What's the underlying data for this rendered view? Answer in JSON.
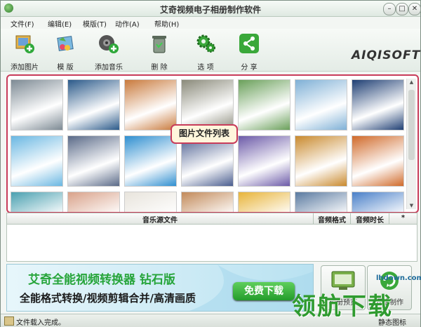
{
  "window": {
    "title": "艾奇视频电子相册制作软件"
  },
  "menu": [
    {
      "label": "文件(F)"
    },
    {
      "label": "编辑(E)"
    },
    {
      "label": "模版(T)"
    },
    {
      "label": "动作(A)"
    },
    {
      "label": "帮助(H)"
    }
  ],
  "toolbar": [
    {
      "label": "添加图片",
      "icon": "add-image-icon"
    },
    {
      "label": "模 版",
      "icon": "template-icon"
    },
    {
      "label": "添加音乐",
      "icon": "add-music-icon"
    },
    {
      "label": "删 除",
      "icon": "trash-icon"
    },
    {
      "label": "选 项",
      "icon": "gear-icon"
    },
    {
      "label": "分 享",
      "icon": "share-icon"
    }
  ],
  "logo": "AIQISOFT",
  "image_list": {
    "callout": "图片文件列表",
    "thumbnails": [
      {
        "subject": "eiffel-tower",
        "color": "#7d8a94"
      },
      {
        "subject": "earth-orbit",
        "color": "#2b5a8a"
      },
      {
        "subject": "stonehenge",
        "color": "#c97a3c"
      },
      {
        "subject": "stones-flowers",
        "color": "#8a8a7a"
      },
      {
        "subject": "duckling",
        "color": "#6aa05a"
      },
      {
        "subject": "ferris-wheel",
        "color": "#7fb0d6"
      },
      {
        "subject": "sydney-bridge",
        "color": "#1f3f74"
      },
      {
        "subject": "blue-eiffel",
        "color": "#6ab7e2"
      },
      {
        "subject": "colosseum",
        "color": "#5a6a88"
      },
      {
        "subject": "water-splash",
        "color": "#2f8fd0"
      },
      {
        "subject": "castle-night",
        "color": "#4a5d8f"
      },
      {
        "subject": "tower-bridge",
        "color": "#6c5aa8"
      },
      {
        "subject": "eiffel-sunset",
        "color": "#c98a2e"
      },
      {
        "subject": "desert-rocks",
        "color": "#d06a2a"
      },
      {
        "subject": "woman-portrait",
        "color": "#4aa0b0"
      },
      {
        "subject": "person-closeup",
        "color": "#d9a28a"
      },
      {
        "subject": "sheet-music",
        "color": "#e8e4dc"
      },
      {
        "subject": "palace",
        "color": "#c28a5a"
      },
      {
        "subject": "tulips",
        "color": "#e8b43a"
      },
      {
        "subject": "penguins",
        "color": "#5a7aa0"
      },
      {
        "subject": "sky",
        "color": "#4a80c8"
      }
    ]
  },
  "music_table": {
    "columns": [
      "音乐源文件",
      "音频格式",
      "音频时长",
      "*"
    ]
  },
  "banner": {
    "title": "艾奇全能视频转换器 钻石版",
    "subtitle": "全能格式转换/视频剪辑合并/高清画质",
    "button": "免费下载"
  },
  "actions": [
    {
      "label": "相册预览",
      "icon": "preview-icon"
    },
    {
      "label": "开始制作",
      "icon": "start-icon"
    }
  ],
  "status": {
    "text": "文件载入完成。",
    "right": "静态图标"
  },
  "watermark": {
    "text": "领航下载",
    "url": "lhdown.com"
  }
}
